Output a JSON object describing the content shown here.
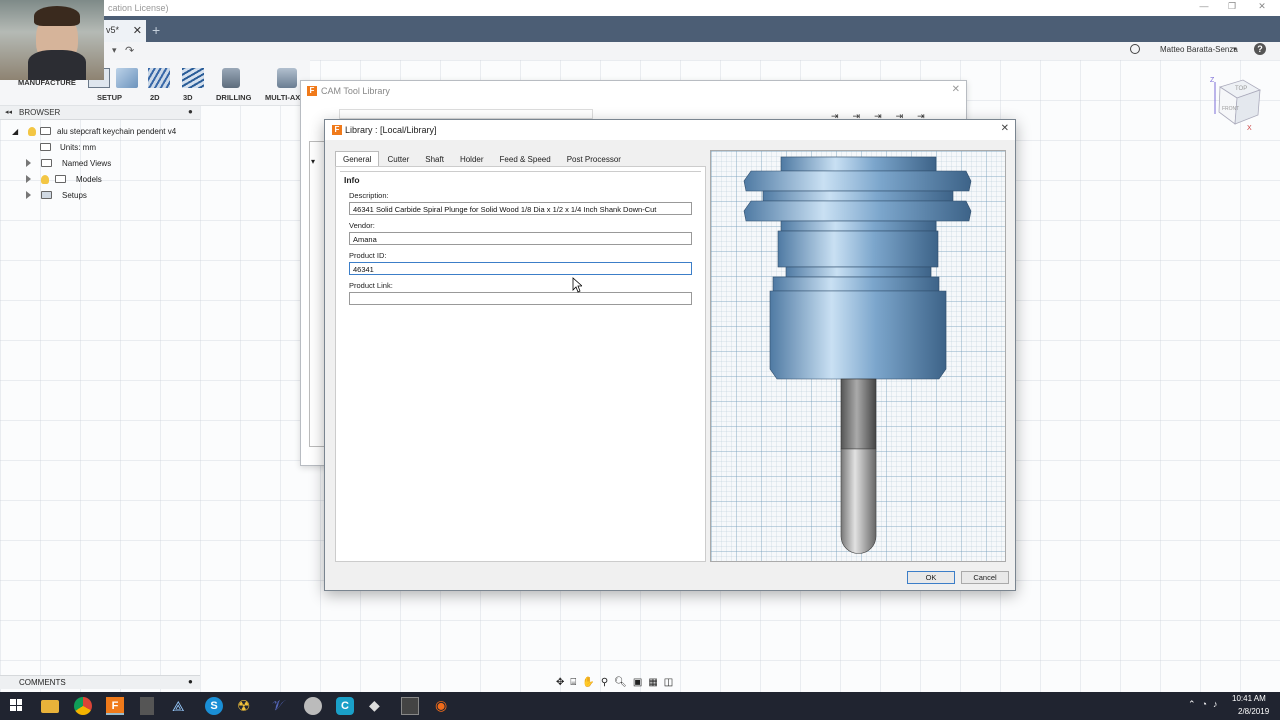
{
  "app": {
    "title_fragment": "cation License)",
    "doc_tab": "v5*",
    "user": "Matteo Baratta-Senza",
    "workspace": "MANUFACTURE"
  },
  "toolbar": {
    "groups": [
      "SETUP",
      "2D",
      "3D",
      "DRILLING",
      "MULTI-AXI"
    ]
  },
  "browser": {
    "header": "BROWSER",
    "root": "alu stepcraft keychain pendent v4",
    "items": [
      "Units: mm",
      "Named Views",
      "Models",
      "Setups"
    ]
  },
  "camlib": {
    "title": "CAM Tool Library"
  },
  "dialog": {
    "title": "Library : [Local/Library]",
    "tabs": [
      "General",
      "Cutter",
      "Shaft",
      "Holder",
      "Feed & Speed",
      "Post Processor"
    ],
    "active_tab": "General",
    "section": "Info",
    "fields": {
      "description_label": "Description:",
      "description_value": "46341 Solid Carbide Spiral Plunge for Solid Wood 1/8 Dia x 1/2 x 1/4 Inch Shank Down-Cut",
      "vendor_label": "Vendor:",
      "vendor_value": "Amana",
      "product_id_label": "Product ID:",
      "product_id_value": "46341",
      "product_link_label": "Product Link:",
      "product_link_value": ""
    },
    "ok_label": "OK",
    "cancel_label": "Cancel"
  },
  "comments": {
    "label": "COMMENTS"
  },
  "taskbar": {
    "time": "10:41 AM",
    "date": "2/8/2019"
  },
  "colors": {
    "accent": "#3c7ec8",
    "tabbar": "#4c5e75",
    "fusion_orange": "#f07a1a"
  }
}
